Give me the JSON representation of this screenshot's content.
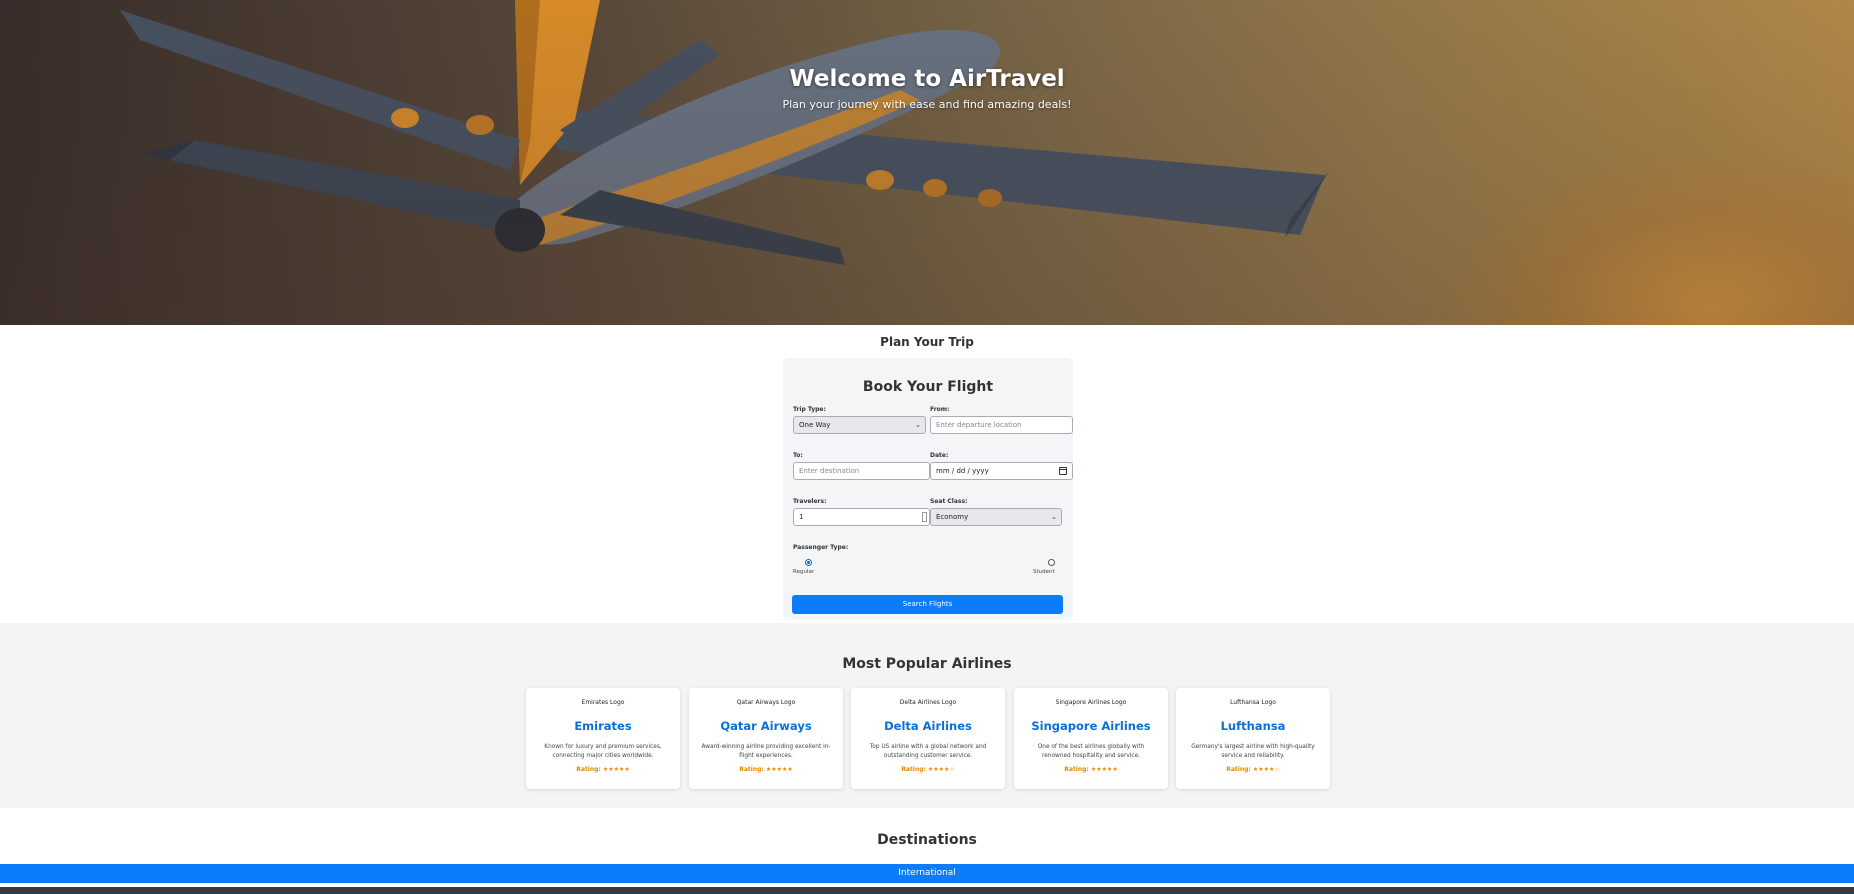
{
  "hero": {
    "title": "Welcome to AirTravel",
    "subtitle": "Plan your journey with ease and find amazing deals!"
  },
  "plan": {
    "section_title": "Plan Your Trip",
    "form_title": "Book Your Flight",
    "trip_type": {
      "label": "Trip Type:",
      "value": "One Way"
    },
    "from": {
      "label": "From:",
      "placeholder": "Enter departure location"
    },
    "to": {
      "label": "To:",
      "placeholder": "Enter destination"
    },
    "date": {
      "label": "Date:",
      "placeholder": "mm / dd / yyyy"
    },
    "travelers": {
      "label": "Travelers:",
      "value": "1"
    },
    "seat_class": {
      "label": "Seat Class:",
      "value": "Economy"
    },
    "passenger_type": {
      "label": "Passenger Type:",
      "options": [
        {
          "label": "Regular",
          "selected": true
        },
        {
          "label": "Student",
          "selected": false
        }
      ]
    },
    "search_button": "Search Flights"
  },
  "airlines": {
    "title": "Most Popular Airlines",
    "cards": [
      {
        "logo": "Emirates Logo",
        "name": "Emirates",
        "desc": "Known for luxury and premium services, connecting major cities worldwide.",
        "rating": "Rating: ★★★★★"
      },
      {
        "logo": "Qatar Airways Logo",
        "name": "Qatar Airways",
        "desc": "Award-winning airline providing excellent in-flight experiences.",
        "rating": "Rating: ★★★★★"
      },
      {
        "logo": "Delta Airlines Logo",
        "name": "Delta Airlines",
        "desc": "Top US airline with a global network and outstanding customer service.",
        "rating": "Rating: ★★★★☆"
      },
      {
        "logo": "Singapore Airlines Logo",
        "name": "Singapore Airlines",
        "desc": "One of the best airlines globally with renowned hospitality and service.",
        "rating": "Rating: ★★★★★"
      },
      {
        "logo": "Lufthansa Logo",
        "name": "Lufthansa",
        "desc": "Germany's largest airline with high-quality service and reliability.",
        "rating": "Rating: ★★★★☆"
      }
    ]
  },
  "destinations": {
    "title": "Destinations",
    "active_tab": "International"
  },
  "colors": {
    "accent": "#0b7dfb",
    "link": "#0a6fd6",
    "rating": "#e08a00"
  }
}
